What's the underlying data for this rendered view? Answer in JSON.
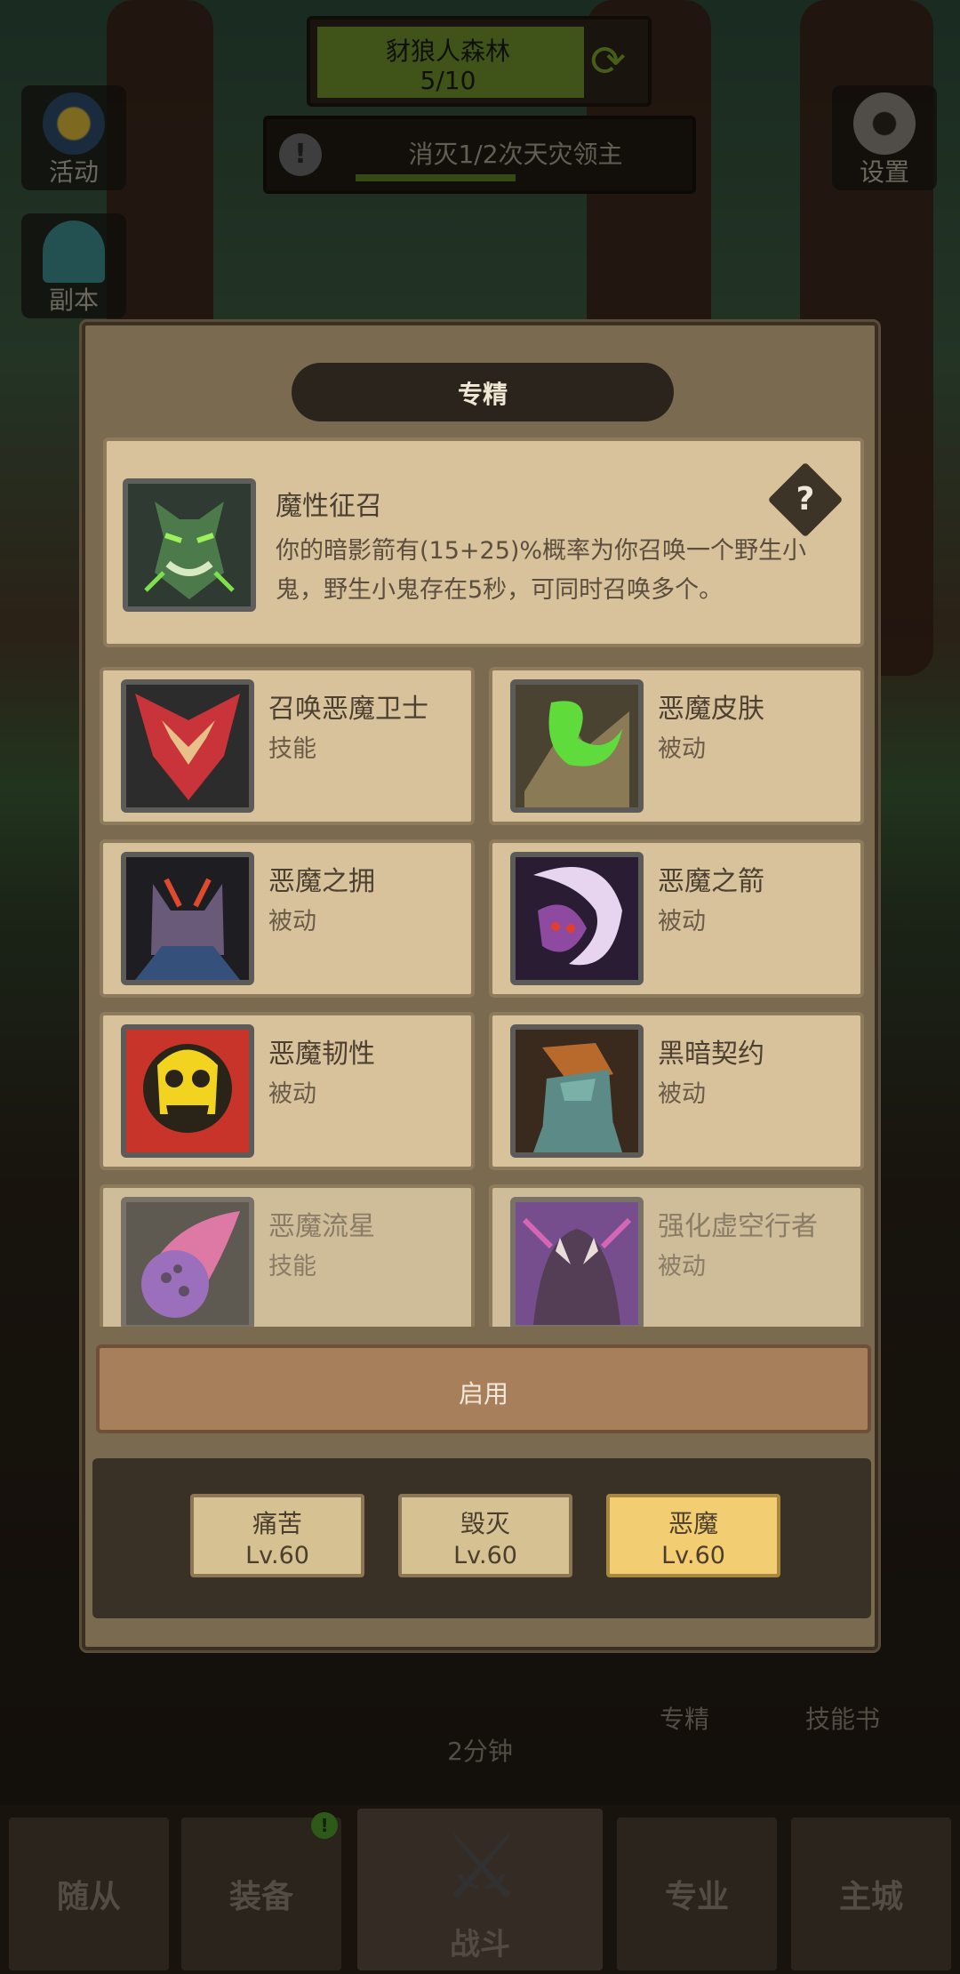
{
  "hud": {
    "zone_name": "豺狼人森林",
    "zone_progress": "5/10",
    "quest_text": "消灭1/2次天灾领主",
    "quest_progress": 0.45,
    "activity_label": "活动",
    "dungeon_label": "副本",
    "settings_label": "设置"
  },
  "dialog": {
    "title": "专精",
    "selected": {
      "name": "魔性征召",
      "description": "你的暗影箭有(15+25)%概率为你召唤一个野生小鬼，野生小鬼存在5秒，可同时召唤多个。"
    },
    "skills": [
      {
        "name": "召唤恶魔卫士",
        "type": "技能",
        "icon": "demon-guard-icon"
      },
      {
        "name": "恶魔皮肤",
        "type": "被动",
        "icon": "demon-skin-icon"
      },
      {
        "name": "恶魔之拥",
        "type": "被动",
        "icon": "demon-embrace-icon"
      },
      {
        "name": "恶魔之箭",
        "type": "被动",
        "icon": "demon-bolt-icon"
      },
      {
        "name": "恶魔韧性",
        "type": "被动",
        "icon": "demon-resilience-icon"
      },
      {
        "name": "黑暗契约",
        "type": "被动",
        "icon": "dark-pact-icon"
      },
      {
        "name": "恶魔流星",
        "type": "技能",
        "icon": "demon-meteor-icon"
      },
      {
        "name": "强化虚空行者",
        "type": "被动",
        "icon": "voidwalker-icon"
      }
    ],
    "enable_label": "启用",
    "specs": [
      {
        "name": "痛苦",
        "level": "Lv.60"
      },
      {
        "name": "毁灭",
        "level": "Lv.60"
      },
      {
        "name": "恶魔",
        "level": "Lv.60"
      }
    ],
    "active_spec": "恶魔"
  },
  "under": {
    "timer": "2分钟",
    "spec_label": "专精",
    "skillbook_label": "技能书"
  },
  "nav": {
    "followers": "随从",
    "equipment": "装备",
    "battle": "战斗",
    "profession": "专业",
    "city": "主城",
    "equipment_badge": "!"
  },
  "colors": {
    "panel": "#d8c29b",
    "active_tab": "#f2cd72",
    "button": "#a87f5b"
  }
}
